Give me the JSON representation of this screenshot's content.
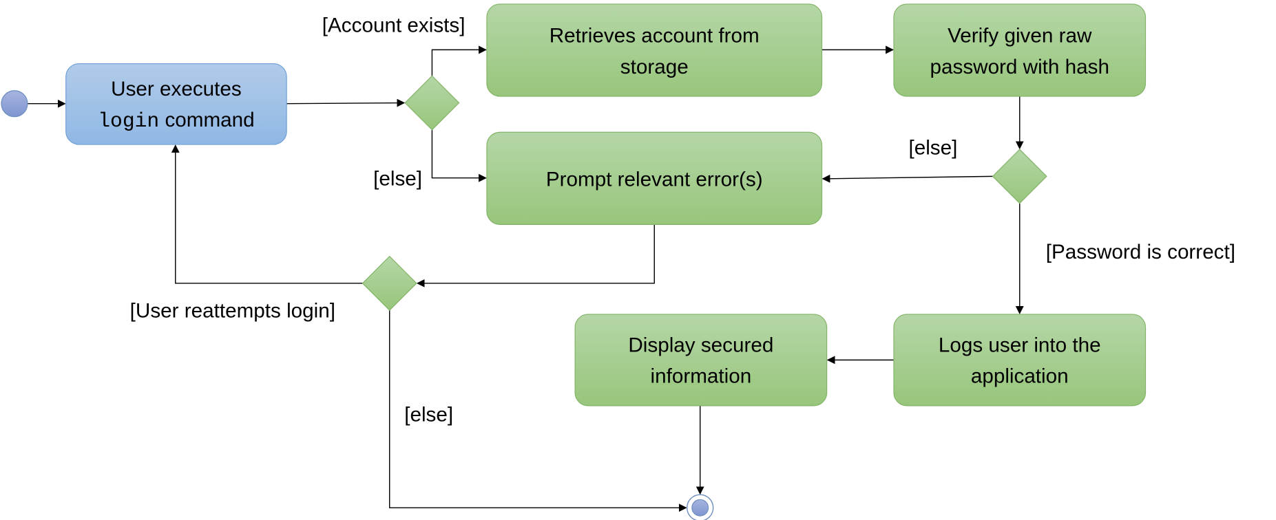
{
  "colors": {
    "start_node": "#8fa3d8",
    "blue_box_top": "#b1cbe9",
    "blue_box_bottom": "#90b8e4",
    "blue_border": "#6d9fd8",
    "green_top": "#b5d6a7",
    "green_bottom": "#97c67b",
    "green_border": "#82b366"
  },
  "nodes": {
    "user_executes": {
      "line1": "User executes",
      "code": "login",
      "line2_rest": " command"
    },
    "retrieves": {
      "line1": "Retrieves account from",
      "line2": "storage"
    },
    "verify": {
      "line1": "Verify given raw",
      "line2": "password with hash"
    },
    "prompt": {
      "line1": "Prompt relevant error(s)"
    },
    "display": {
      "line1": "Display secured",
      "line2": "information"
    },
    "logs": {
      "line1": "Logs user into the",
      "line2": "application"
    }
  },
  "guards": {
    "account_exists": "[Account exists]",
    "else_account": "[else]",
    "else_password": "[else]",
    "password_correct": "[Password is correct]",
    "user_reattempts": "[User reattempts login]",
    "else_reattempt": "[else]"
  }
}
